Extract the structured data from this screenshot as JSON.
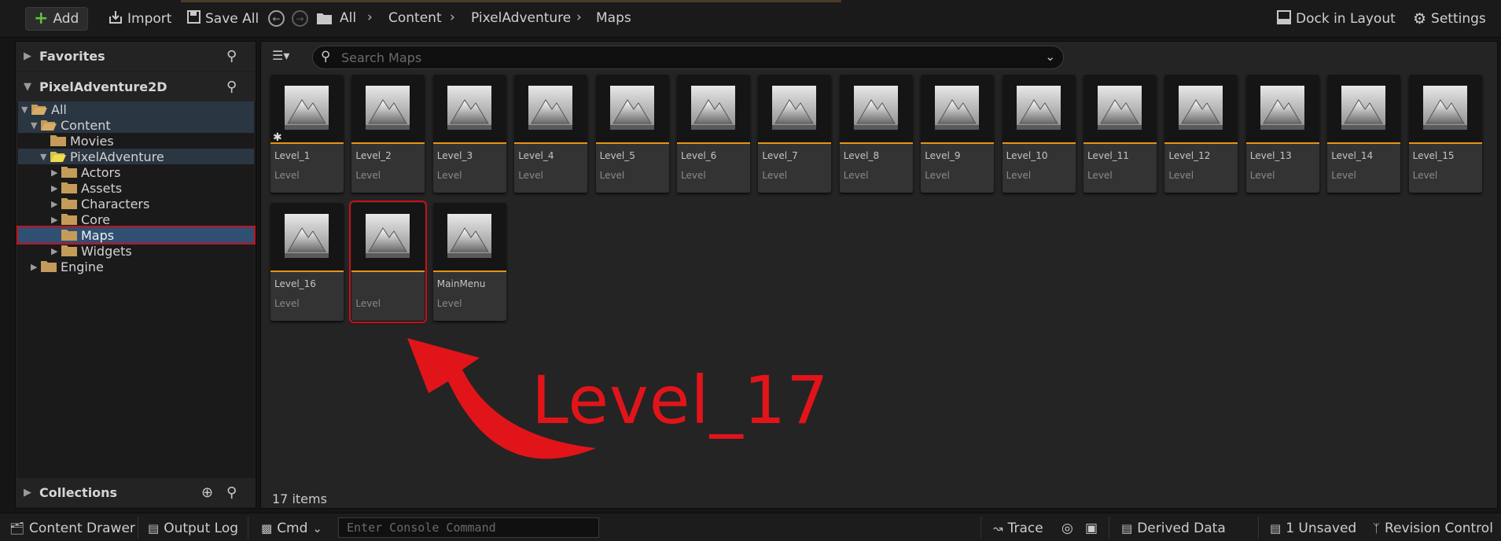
{
  "toolbar": {
    "add_label": "Add",
    "import_label": "Import",
    "save_all_label": "Save All",
    "breadcrumb": [
      "All",
      "Content",
      "PixelAdventure",
      "Maps"
    ],
    "dock_label": "Dock in Layout",
    "settings_label": "Settings"
  },
  "sidebar": {
    "favorites_label": "Favorites",
    "project_label": "PixelAdventure2D",
    "collections_label": "Collections",
    "tree": [
      {
        "label": "All"
      },
      {
        "label": "Content"
      },
      {
        "label": "Movies"
      },
      {
        "label": "PixelAdventure"
      },
      {
        "label": "Actors"
      },
      {
        "label": "Assets"
      },
      {
        "label": "Characters"
      },
      {
        "label": "Core"
      },
      {
        "label": "Maps"
      },
      {
        "label": "Widgets"
      },
      {
        "label": "Engine"
      }
    ]
  },
  "search": {
    "placeholder": "Search Maps"
  },
  "assets": [
    {
      "name": "Level_1",
      "type": "Level"
    },
    {
      "name": "Level_2",
      "type": "Level"
    },
    {
      "name": "Level_3",
      "type": "Level"
    },
    {
      "name": "Level_4",
      "type": "Level"
    },
    {
      "name": "Level_5",
      "type": "Level"
    },
    {
      "name": "Level_6",
      "type": "Level"
    },
    {
      "name": "Level_7",
      "type": "Level"
    },
    {
      "name": "Level_8",
      "type": "Level"
    },
    {
      "name": "Level_9",
      "type": "Level"
    },
    {
      "name": "Level_10",
      "type": "Level"
    },
    {
      "name": "Level_11",
      "type": "Level"
    },
    {
      "name": "Level_12",
      "type": "Level"
    },
    {
      "name": "Level_13",
      "type": "Level"
    },
    {
      "name": "Level_14",
      "type": "Level"
    },
    {
      "name": "Level_15",
      "type": "Level"
    },
    {
      "name": "Level_16",
      "type": "Level"
    },
    {
      "name": "",
      "type": "Level"
    },
    {
      "name": "MainMenu",
      "type": "Level"
    }
  ],
  "items_count": "17 items",
  "annotation": {
    "text": "Level_17",
    "color": "#e1141a"
  },
  "statusbar": {
    "content_drawer": "Content Drawer",
    "output_log": "Output Log",
    "cmd": "Cmd",
    "console_placeholder": "Enter Console Command",
    "trace": "Trace",
    "derived_data": "Derived Data",
    "unsaved": "1 Unsaved",
    "revision_control": "Revision Control"
  },
  "colors": {
    "accent_orange": "#e59514",
    "selection_blue": "#2f4f73",
    "add_green": "#5fc13a"
  }
}
